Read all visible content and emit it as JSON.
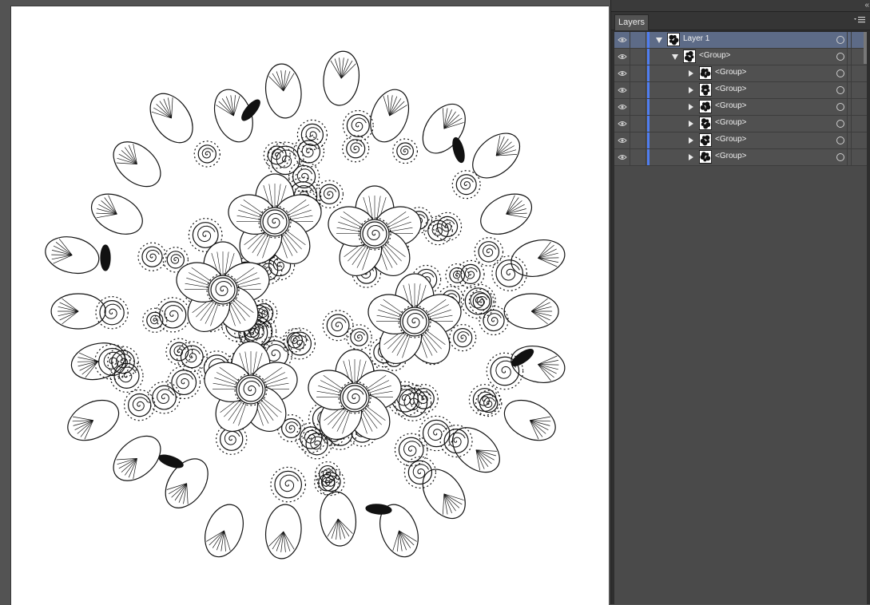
{
  "panel": {
    "tab_label": "Layers",
    "collapse_glyph": "«",
    "menu_icon": "panel-menu-icon"
  },
  "layers": [
    {
      "name": "Layer 1",
      "depth": 0,
      "expanded": true,
      "selected": true
    },
    {
      "name": "<Group>",
      "depth": 1,
      "expanded": true,
      "selected": false
    },
    {
      "name": "<Group>",
      "depth": 2,
      "expanded": false,
      "selected": false
    },
    {
      "name": "<Group>",
      "depth": 2,
      "expanded": false,
      "selected": false
    },
    {
      "name": "<Group>",
      "depth": 2,
      "expanded": false,
      "selected": false
    },
    {
      "name": "<Group>",
      "depth": 2,
      "expanded": false,
      "selected": false
    },
    {
      "name": "<Group>",
      "depth": 2,
      "expanded": false,
      "selected": false
    },
    {
      "name": "<Group>",
      "depth": 2,
      "expanded": false,
      "selected": false
    }
  ],
  "colors": {
    "layer_color": "#4f7df0",
    "selected_row": "#5d6b87",
    "panel_bg": "#4d4d4d",
    "canvas_bg": "#535353"
  }
}
